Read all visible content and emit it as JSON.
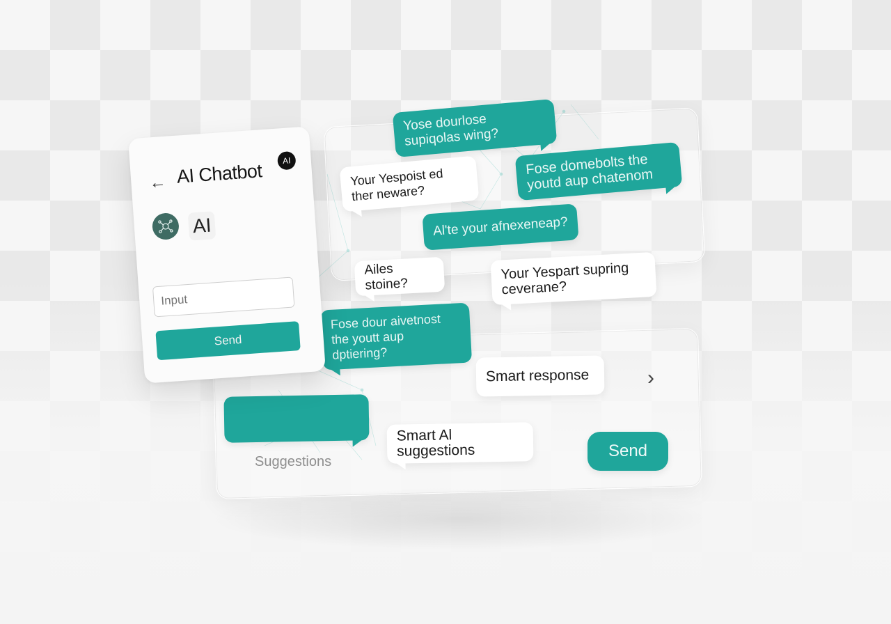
{
  "chatbot_card": {
    "back_icon": "arrow-left-icon",
    "title": "AI Chatbot",
    "badge": "AI",
    "avatar_icon": "network-node-icon",
    "avatar_label": "AI",
    "input": {
      "placeholder": "Input",
      "value": ""
    },
    "send_label": "Send"
  },
  "conversation": {
    "bubbles": [
      {
        "text": "Yose dourlose supiqolas wing?",
        "style": "teal"
      },
      {
        "text": "Your Yespoist ed ther neware?",
        "style": "white"
      },
      {
        "text": "Fose domebolts the youtd aup chatenom",
        "style": "teal"
      },
      {
        "text": "Al'te your afnexeneap?",
        "style": "teal"
      },
      {
        "text": "Ailes stoine?",
        "style": "white"
      },
      {
        "text": "Your Yespart supring ceverane?",
        "style": "white"
      },
      {
        "text": "Fose dour aivetnost the youtt aup dptiering?",
        "style": "teal"
      },
      {
        "text": "Smart response",
        "style": "white"
      },
      {
        "text": "Smart Al suggestions",
        "style": "white"
      },
      {
        "text": "",
        "style": "teal"
      }
    ],
    "chevron_icon": "chevron-right-icon",
    "send_label": "Send",
    "suggestions_label": "Suggestions"
  },
  "colors": {
    "accent": "#1fa69b",
    "avatar_bg": "#3e6b63",
    "badge_bg": "#111111"
  }
}
